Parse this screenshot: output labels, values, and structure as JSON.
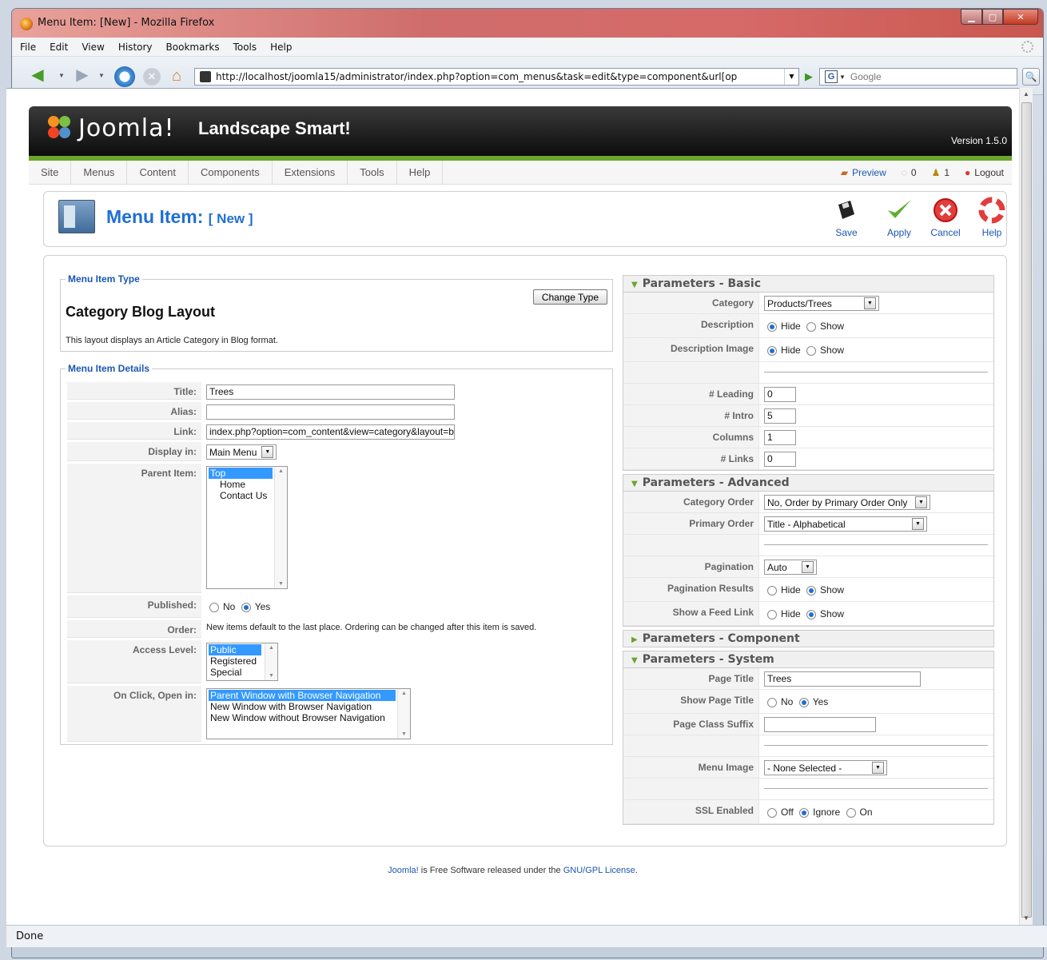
{
  "browser": {
    "window_title": "Menu Item: [New] - Mozilla Firefox",
    "menu": [
      "File",
      "Edit",
      "View",
      "History",
      "Bookmarks",
      "Tools",
      "Help"
    ],
    "url": "http://localhost/joomla15/administrator/index.php?option=com_menus&task=edit&type=component&url[op",
    "search_placeholder": "Google",
    "status": "Done"
  },
  "joomla": {
    "logo_text": "Joomla!",
    "site_name": "Landscape Smart!",
    "version": "Version 1.5.0",
    "menu": [
      "Site",
      "Menus",
      "Content",
      "Components",
      "Extensions",
      "Tools",
      "Help"
    ],
    "status": {
      "preview": "Preview",
      "messages": "0",
      "users": "1",
      "logout": "Logout"
    }
  },
  "toolbar": {
    "title": "Menu Item:",
    "subtitle": "[ New ]",
    "save": "Save",
    "apply": "Apply",
    "cancel": "Cancel",
    "help": "Help"
  },
  "menu_item_type": {
    "legend": "Menu Item Type",
    "change_type": "Change Type",
    "type_name": "Category Blog Layout",
    "description": "This layout displays an Article Category in Blog format."
  },
  "details": {
    "legend": "Menu Item Details",
    "title_label": "Title:",
    "title_value": "Trees",
    "alias_label": "Alias:",
    "alias_value": "",
    "link_label": "Link:",
    "link_value": "index.php?option=com_content&view=category&layout=b",
    "display_label": "Display in:",
    "display_value": "Main Menu",
    "parent_label": "Parent Item:",
    "parent_options": [
      "Top",
      "Home",
      "Contact Us"
    ],
    "published_label": "Published:",
    "no": "No",
    "yes": "Yes",
    "order_label": "Order:",
    "order_text": "New items default to the last place. Ordering can be changed after this item is saved.",
    "access_label": "Access Level:",
    "access_options": [
      "Public",
      "Registered",
      "Special"
    ],
    "onclick_label": "On Click, Open in:",
    "onclick_options": [
      "Parent Window with Browser Navigation",
      "New Window with Browser Navigation",
      "New Window without Browser Navigation"
    ]
  },
  "params_basic": {
    "header": "Parameters - Basic",
    "category_label": "Category",
    "category_value": "Products/Trees",
    "description_label": "Description",
    "description_image_label": "Description Image",
    "hide": "Hide",
    "show": "Show",
    "leading_label": "# Leading",
    "leading_value": "0",
    "intro_label": "# Intro",
    "intro_value": "5",
    "columns_label": "Columns",
    "columns_value": "1",
    "links_label": "# Links",
    "links_value": "0"
  },
  "params_advanced": {
    "header": "Parameters - Advanced",
    "category_order_label": "Category Order",
    "category_order_value": "No, Order by Primary Order Only",
    "primary_order_label": "Primary Order",
    "primary_order_value": "Title - Alphabetical",
    "pagination_label": "Pagination",
    "pagination_value": "Auto",
    "pagination_results_label": "Pagination Results",
    "feed_link_label": "Show a Feed Link",
    "hide": "Hide",
    "show": "Show"
  },
  "params_component": {
    "header": "Parameters - Component"
  },
  "params_system": {
    "header": "Parameters - System",
    "page_title_label": "Page Title",
    "page_title_value": "Trees",
    "show_page_title_label": "Show Page Title",
    "no": "No",
    "yes": "Yes",
    "page_class_label": "Page Class Suffix",
    "page_class_value": "",
    "menu_image_label": "Menu Image",
    "menu_image_value": "- None Selected -",
    "ssl_label": "SSL Enabled",
    "off": "Off",
    "ignore": "Ignore",
    "on": "On"
  },
  "footer": {
    "joomla_link": "Joomla!",
    "text": " is Free Software released under the ",
    "license_link": "GNU/GPL License",
    "end": "."
  }
}
